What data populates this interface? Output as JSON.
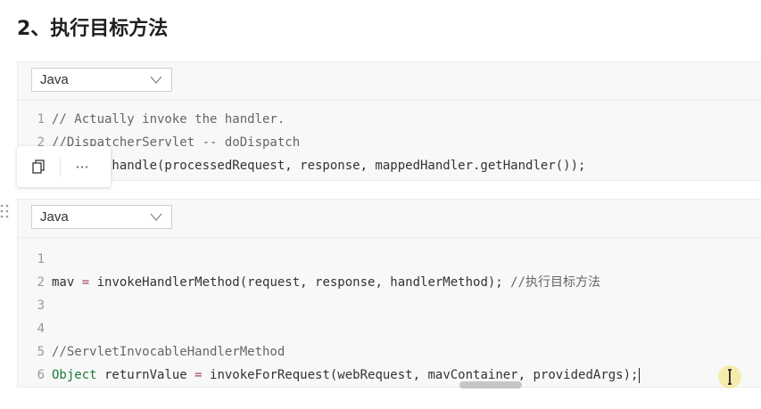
{
  "heading": "2、执行目标方法",
  "toolbar": {
    "copy_icon": "copy-icon",
    "more_label": "···"
  },
  "blocks": [
    {
      "language": "Java",
      "lines": [
        {
          "num": "1",
          "segments": [
            {
              "cls": "cmt",
              "text": "// Actually invoke the handler."
            }
          ]
        },
        {
          "num": "2",
          "segments": [
            {
              "cls": "cmt",
              "text": "//DispatcherServlet -- doDispatch"
            }
          ]
        },
        {
          "num": "3",
          "segments": [
            {
              "cls": "",
              "text": "mv = ha.handle(processedRequest, response, mappedHandler.getHandler());"
            }
          ]
        }
      ]
    },
    {
      "language": "Java",
      "lines": [
        {
          "num": "1",
          "segments": []
        },
        {
          "num": "2",
          "segments": [
            {
              "cls": "",
              "text": "mav "
            },
            {
              "cls": "op",
              "text": "="
            },
            {
              "cls": "",
              "text": " invokeHandlerMethod(request, response, handlerMethod); "
            },
            {
              "cls": "cmt",
              "text": "//执行目标方法"
            }
          ]
        },
        {
          "num": "3",
          "segments": []
        },
        {
          "num": "4",
          "segments": []
        },
        {
          "num": "5",
          "segments": [
            {
              "cls": "cmt",
              "text": "//ServletInvocableHandlerMethod"
            }
          ]
        },
        {
          "num": "6",
          "segments": [
            {
              "cls": "type",
              "text": "Object"
            },
            {
              "cls": "",
              "text": " returnValue "
            },
            {
              "cls": "op",
              "text": "="
            },
            {
              "cls": "",
              "text": " invokeForRequest(webRequest, mavContainer, providedArgs);"
            }
          ]
        }
      ]
    }
  ]
}
